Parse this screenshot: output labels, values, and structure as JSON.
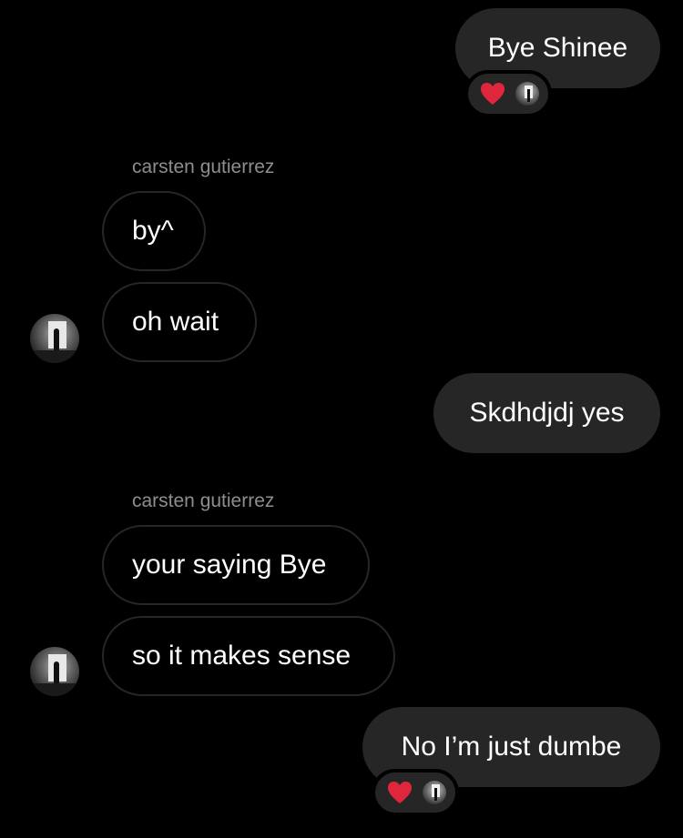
{
  "messages": [
    {
      "direction": "outgoing",
      "text": "Bye Shinee",
      "reactions": [
        "heart-icon",
        "reactor-avatar"
      ]
    },
    {
      "direction": "incoming",
      "sender": "carsten gutierrez",
      "text": "by^"
    },
    {
      "direction": "incoming",
      "text": "oh wait"
    },
    {
      "direction": "outgoing",
      "text": "Skdhdjdj yes"
    },
    {
      "direction": "incoming",
      "sender": "carsten gutierrez",
      "text": "your saying Bye"
    },
    {
      "direction": "incoming",
      "text": "so it makes sense"
    },
    {
      "direction": "outgoing",
      "text": "No I’m just dumbe",
      "reactions": [
        "heart-icon",
        "reactor-avatar"
      ]
    }
  ],
  "colors": {
    "background": "#000000",
    "outgoing_bubble": "#262626",
    "incoming_border": "#262626",
    "text": "#ffffff",
    "sender_name": "#8e8e8e",
    "heart": "#e0263c"
  }
}
